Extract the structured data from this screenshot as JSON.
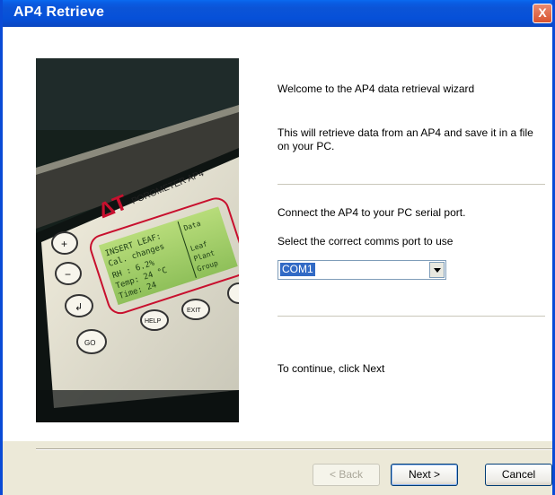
{
  "window": {
    "title": "AP4 Retrieve",
    "close_label": "X"
  },
  "photo": {
    "brand": "ΔT",
    "model": "POROMETER AP4",
    "lcd_lines": [
      "INSERT LEAF:",
      "Cal. changes",
      "RH  :  6.2%",
      "Temp: 24 °C",
      "Time: 24"
    ],
    "lcd_side": [
      "Data",
      "Leaf",
      "Plant",
      "Group"
    ],
    "keys": [
      "+",
      "−",
      "↲",
      "GO",
      "HELP",
      "EXIT"
    ]
  },
  "wizard": {
    "welcome": "Welcome to the AP4 data retrieval wizard",
    "description": "This will retrieve data from an AP4 and save it in a file on your PC.",
    "connect": "Connect the AP4 to your PC serial port.",
    "select_port": "Select the correct comms port to use",
    "port_value": "COM1",
    "continue": "To continue, click Next"
  },
  "buttons": {
    "back": "< Back",
    "next": "Next >",
    "cancel": "Cancel"
  }
}
